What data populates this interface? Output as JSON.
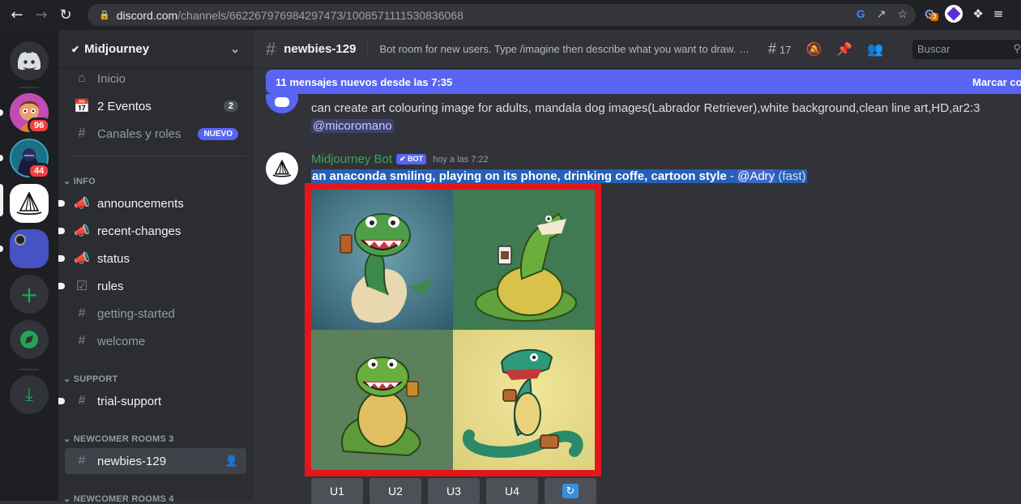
{
  "browser": {
    "url_host": "discord.com",
    "url_path": "/channels/662267976984297473/1008571111530836068",
    "extension_badge": "3"
  },
  "rail": {
    "servers": [
      {
        "name": "server-1",
        "badge": "96"
      },
      {
        "name": "server-2",
        "badge": "44"
      }
    ]
  },
  "server": {
    "name": "Midjourney",
    "inicio": "Inicio",
    "eventos": "2 Eventos",
    "eventos_count": "2",
    "canales": "Canales y roles",
    "nuevo": "NUEVO",
    "cat_info": "INFO",
    "cat_support": "SUPPORT",
    "cat_newcomer3": "NEWCOMER ROOMS 3",
    "cat_newcomer4": "NEWCOMER ROOMS 4",
    "channels": {
      "announcements": "announcements",
      "recent_changes": "recent-changes",
      "status": "status",
      "rules": "rules",
      "getting_started": "getting-started",
      "welcome": "welcome",
      "trial_support": "trial-support",
      "newbies": "newbies-129"
    }
  },
  "channel": {
    "name": "newbies-129",
    "topic": "Bot room for new users. Type /imagine then describe what you want to draw. See https://docs.midjourney.com for more information",
    "threads_count": "17",
    "search_placeholder": "Buscar"
  },
  "new_messages": {
    "text": "11 mensajes nuevos desde las 7:35",
    "mark": "Marcar como leído"
  },
  "messages": [
    {
      "text": "can create art colouring image for adults, mandala dog images(Labrador Retriever),white background,clean line art,HD,ar2:3",
      "mention": "@micoromano"
    },
    {
      "author": "Midjourney Bot",
      "bot_tag": "BOT",
      "time": "hoy a las 7:22",
      "prompt": "an anaconda smiling, playing on its phone, drinking coffe, cartoon style",
      "dash": " - ",
      "mention": "@Adry",
      "speed": "(fast)"
    }
  ],
  "buttons": {
    "u1": "U1",
    "u2": "U2",
    "u3": "U3",
    "u4": "U4"
  },
  "colors": {
    "blurple": "#5865f2",
    "highlight_red": "#e3161c",
    "bot_green": "#3ba55d"
  }
}
